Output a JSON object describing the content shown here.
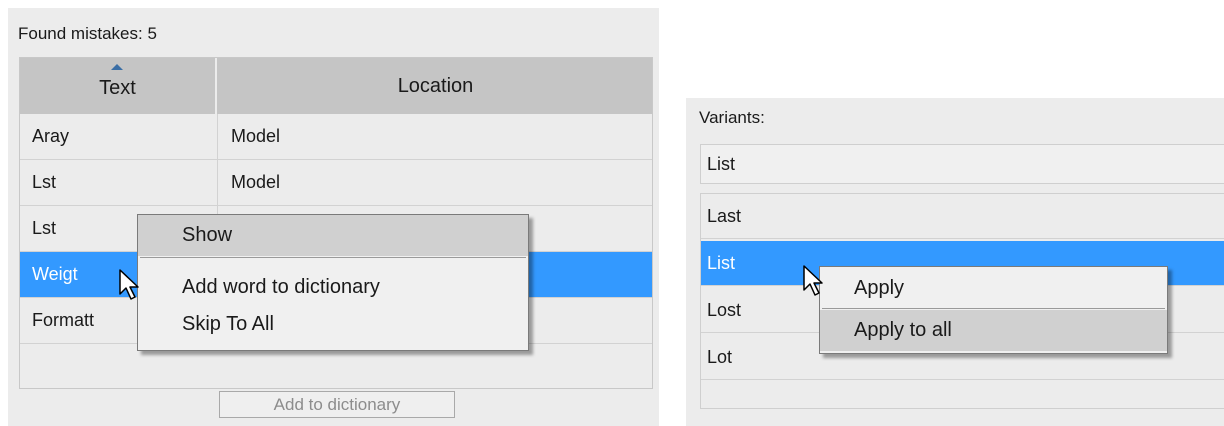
{
  "left": {
    "found_label": "Found mistakes: 5",
    "columns": {
      "text": "Text",
      "location": "Location"
    },
    "rows": [
      {
        "text": "Aray",
        "location": "Model"
      },
      {
        "text": "Lst",
        "location": "Model"
      },
      {
        "text": "Lst",
        "location": ""
      },
      {
        "text": "Weigt",
        "location": ""
      },
      {
        "text": "Formatt",
        "location": ""
      }
    ],
    "add_button": "Add to dictionary",
    "context_menu": [
      "Show",
      "Add word to dictionary",
      "Skip To All"
    ]
  },
  "right": {
    "variants_label": "Variants:",
    "input_value": "List",
    "items": [
      "Last",
      "List",
      "Lost",
      "Lot"
    ],
    "context_menu": [
      "Apply",
      "Apply to all"
    ]
  },
  "colors": {
    "selection": "#3399ff",
    "panel": "#ececec",
    "header": "#c5c5c5"
  }
}
